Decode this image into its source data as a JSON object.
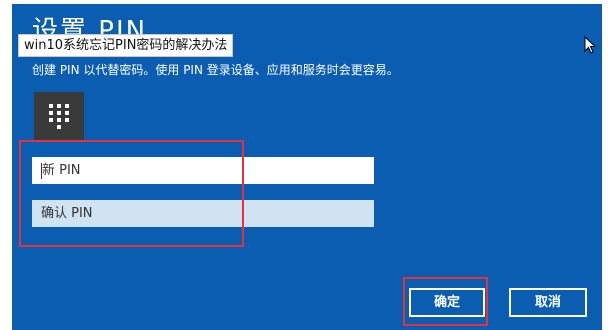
{
  "dialog": {
    "title": "设置 PIN",
    "subtitle": "创建 PIN 以代替密码。使用 PIN 登录设备、应用和服务时会更容易。",
    "keypad_icon": "keypad-icon",
    "new_pin_placeholder": "新 PIN",
    "confirm_pin_placeholder": "确认 PIN",
    "ok_label": "确定",
    "cancel_label": "取消"
  },
  "caption": {
    "text": "win10系统忘记PIN密码的解决办法"
  },
  "colors": {
    "dialog_background": "#0a5db0",
    "confirm_field_background": "#cfe3f3",
    "highlight_border": "#e0333a"
  }
}
